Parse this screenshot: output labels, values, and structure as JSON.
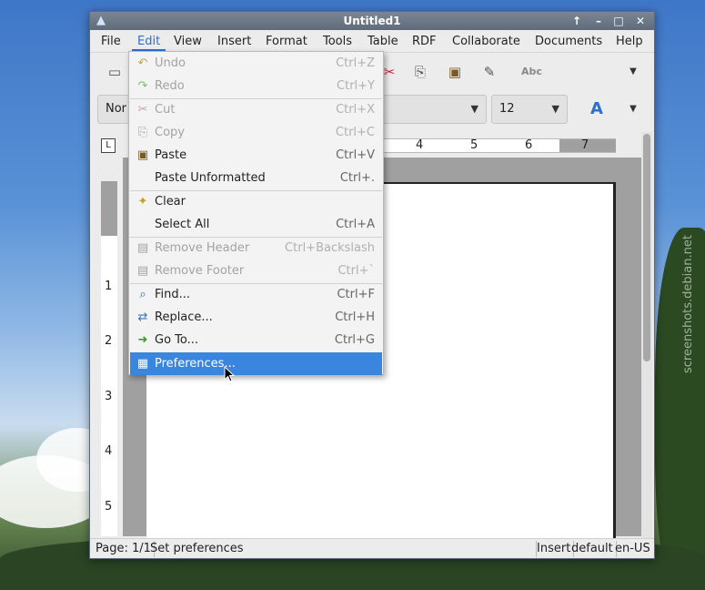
{
  "window": {
    "title": "Untitled1"
  },
  "titlebar_buttons": [
    "↑",
    "–",
    "□",
    "✕"
  ],
  "menubar": [
    "File",
    "Edit",
    "View",
    "Insert",
    "Format",
    "Tools",
    "Table",
    "RDF",
    "Collaborate",
    "Documents",
    "Help"
  ],
  "toolbar2": {
    "style_value": "Nor",
    "font_value": "",
    "size_value": "12"
  },
  "ruler": {
    "h_numbers": [
      "4",
      "5",
      "6",
      "7"
    ],
    "v_numbers": [
      "1",
      "2",
      "3",
      "4",
      "5"
    ],
    "corner": "L"
  },
  "edit_menu": [
    {
      "label": "Undo",
      "shortcut": "Ctrl+Z",
      "icon": "undo-icon",
      "glyph": "↶",
      "disabled": true
    },
    {
      "label": "Redo",
      "shortcut": "Ctrl+Y",
      "icon": "redo-icon",
      "glyph": "↷",
      "disabled": true
    },
    {
      "label": "Cut",
      "shortcut": "Ctrl+X",
      "icon": "scissors-icon",
      "glyph": "✂",
      "disabled": true
    },
    {
      "label": "Copy",
      "shortcut": "Ctrl+C",
      "icon": "copy-icon",
      "glyph": "⎘",
      "disabled": true
    },
    {
      "label": "Paste",
      "shortcut": "Ctrl+V",
      "icon": "clipboard-icon",
      "glyph": "📋",
      "disabled": false
    },
    {
      "label": "Paste Unformatted",
      "shortcut": "Ctrl+.",
      "icon": "",
      "glyph": "",
      "disabled": false
    },
    {
      "label": "Clear",
      "shortcut": "",
      "icon": "broom-icon",
      "glyph": "🧹",
      "disabled": false
    },
    {
      "label": "Select All",
      "shortcut": "Ctrl+A",
      "icon": "",
      "glyph": "",
      "disabled": false
    },
    {
      "label": "Remove Header",
      "shortcut": "Ctrl+Backslash",
      "icon": "remove-header-icon",
      "glyph": "▤",
      "disabled": true
    },
    {
      "label": "Remove Footer",
      "shortcut": "Ctrl+`",
      "icon": "remove-footer-icon",
      "glyph": "▤",
      "disabled": true
    },
    {
      "label": "Find...",
      "shortcut": "Ctrl+F",
      "icon": "find-icon",
      "glyph": "🔍",
      "disabled": false
    },
    {
      "label": "Replace...",
      "shortcut": "Ctrl+H",
      "icon": "replace-icon",
      "glyph": "⇄",
      "disabled": false
    },
    {
      "label": "Go To...",
      "shortcut": "Ctrl+G",
      "icon": "goto-icon",
      "glyph": "➜",
      "disabled": false
    },
    {
      "label": "Preferences...",
      "shortcut": "",
      "icon": "preferences-icon",
      "glyph": "▦",
      "disabled": false,
      "selected": true
    }
  ],
  "statusbar": {
    "page": "Page: 1/1",
    "message": "Set preferences",
    "mode": "Insert",
    "style": "default",
    "lang": "en-US"
  },
  "watermark": "screenshots.debian.net"
}
